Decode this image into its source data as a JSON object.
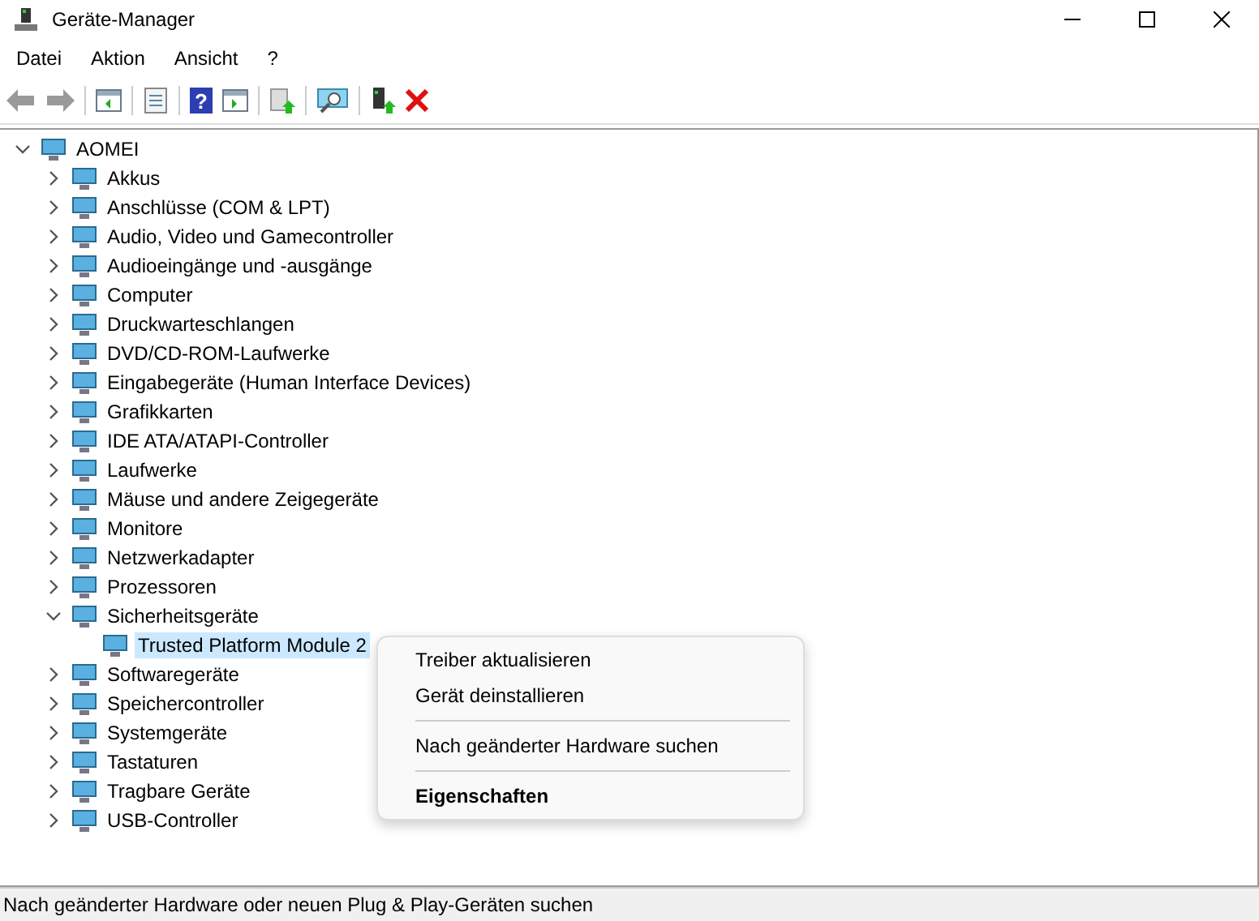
{
  "window": {
    "title": "Geräte-Manager"
  },
  "menu_bar": [
    "Datei",
    "Aktion",
    "Ansicht",
    "?"
  ],
  "toolbar": {
    "help_glyph": "?"
  },
  "tree": {
    "label": "AOMEI",
    "expanded": true,
    "selected": false,
    "children": [
      {
        "label": "Akkus",
        "expanded": false,
        "selected": false
      },
      {
        "label": "Anschlüsse (COM & LPT)",
        "expanded": false,
        "selected": false
      },
      {
        "label": "Audio, Video und Gamecontroller",
        "expanded": false,
        "selected": false
      },
      {
        "label": "Audioeingänge und -ausgänge",
        "expanded": false,
        "selected": false
      },
      {
        "label": "Computer",
        "expanded": false,
        "selected": false
      },
      {
        "label": "Druckwarteschlangen",
        "expanded": false,
        "selected": false
      },
      {
        "label": "DVD/CD-ROM-Laufwerke",
        "expanded": false,
        "selected": false
      },
      {
        "label": "Eingabegeräte (Human Interface Devices)",
        "expanded": false,
        "selected": false
      },
      {
        "label": "Grafikkarten",
        "expanded": false,
        "selected": false
      },
      {
        "label": "IDE ATA/ATAPI-Controller",
        "expanded": false,
        "selected": false
      },
      {
        "label": "Laufwerke",
        "expanded": false,
        "selected": false
      },
      {
        "label": "Mäuse und andere Zeigegeräte",
        "expanded": false,
        "selected": false
      },
      {
        "label": "Monitore",
        "expanded": false,
        "selected": false
      },
      {
        "label": "Netzwerkadapter",
        "expanded": false,
        "selected": false
      },
      {
        "label": "Prozessoren",
        "expanded": false,
        "selected": false
      },
      {
        "label": "Sicherheitsgeräte",
        "expanded": true,
        "selected": false,
        "children": [
          {
            "label": "Trusted Platform Module 2",
            "selected": true
          }
        ]
      },
      {
        "label": "Softwaregeräte",
        "expanded": false,
        "selected": false
      },
      {
        "label": "Speichercontroller",
        "expanded": false,
        "selected": false
      },
      {
        "label": "Systemgeräte",
        "expanded": false,
        "selected": false
      },
      {
        "label": "Tastaturen",
        "expanded": false,
        "selected": false
      },
      {
        "label": "Tragbare Geräte",
        "expanded": false,
        "selected": false
      },
      {
        "label": "USB-Controller",
        "expanded": false,
        "selected": false
      }
    ]
  },
  "context_menu": [
    {
      "kind": "item",
      "label": "Treiber aktualisieren",
      "default": false
    },
    {
      "kind": "item",
      "label": "Gerät deinstallieren",
      "default": false
    },
    {
      "kind": "separator"
    },
    {
      "kind": "item",
      "label": "Nach geänderter Hardware suchen",
      "default": false
    },
    {
      "kind": "separator"
    },
    {
      "kind": "item",
      "label": "Eigenschaften",
      "default": true
    }
  ],
  "status_bar": "Nach geänderter Hardware oder neuen Plug & Play-Geräten suchen"
}
